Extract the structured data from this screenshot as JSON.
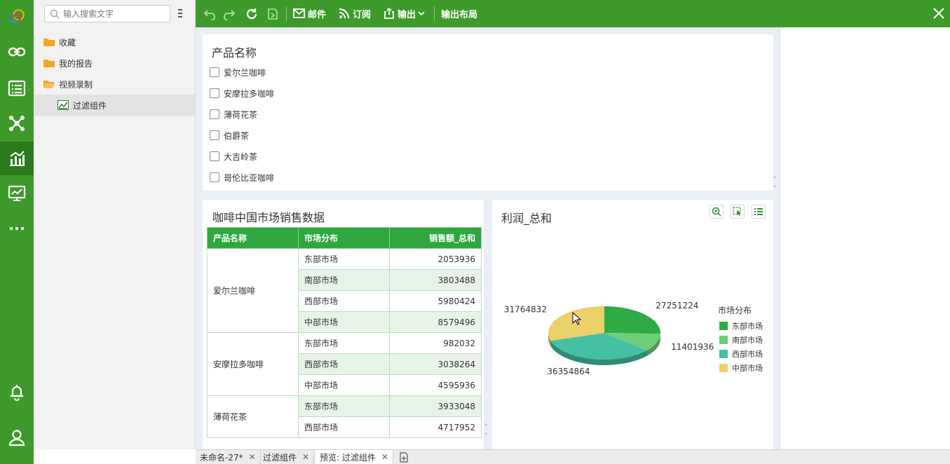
{
  "tree": {
    "search_placeholder": "输入搜索文字",
    "items": [
      {
        "label": "收藏"
      },
      {
        "label": "我的报告"
      },
      {
        "label": "视频录制"
      },
      {
        "label": "过滤组件"
      }
    ]
  },
  "toolbar": {
    "mail": "邮件",
    "subscribe": "订阅",
    "export": "输出",
    "export_layout": "输出布局"
  },
  "filter_widget": {
    "title": "产品名称",
    "options": [
      "爱尔兰咖啡",
      "安摩拉多咖啡",
      "薄荷花茶",
      "伯爵茶",
      "大吉岭茶",
      "哥伦比亚咖啡"
    ]
  },
  "table_widget": {
    "title": "咖啡中国市场销售数据",
    "headers": [
      "产品名称",
      "市场分布",
      "销售额_总和"
    ],
    "groups": [
      {
        "product": "爱尔兰咖啡",
        "rows": [
          {
            "market": "东部市场",
            "value": "2053936"
          },
          {
            "market": "南部市场",
            "value": "3803488"
          },
          {
            "market": "西部市场",
            "value": "5980424"
          },
          {
            "market": "中部市场",
            "value": "8579496"
          }
        ]
      },
      {
        "product": "安摩拉多咖啡",
        "rows": [
          {
            "market": "东部市场",
            "value": "982032"
          },
          {
            "market": "西部市场",
            "value": "3038264"
          },
          {
            "market": "中部市场",
            "value": "4595936"
          }
        ]
      },
      {
        "product": "薄荷花茶",
        "rows": [
          {
            "market": "东部市场",
            "value": "3933048"
          },
          {
            "market": "西部市场",
            "value": "4717952"
          }
        ]
      }
    ]
  },
  "chart_widget": {
    "title": "利润_总和"
  },
  "chart_data": {
    "type": "pie",
    "title": "利润_总和",
    "legend_title": "市场分布",
    "legend_position": "right",
    "categories": [
      "东部市场",
      "南部市场",
      "西部市场",
      "中部市场"
    ],
    "values": [
      27251224,
      11401936,
      36354864,
      31764832
    ],
    "colors": [
      "#2eab45",
      "#6ecf7a",
      "#45c0a4",
      "#ecd06a"
    ]
  },
  "tabs": [
    {
      "label": "未命名-27*"
    },
    {
      "label": "过滤组件"
    },
    {
      "label": "预览: 过滤组件"
    }
  ],
  "colors": {
    "brand": "#3e9a2a",
    "table_header": "#2ea83e",
    "row_stripe": "#e6f4e8"
  }
}
